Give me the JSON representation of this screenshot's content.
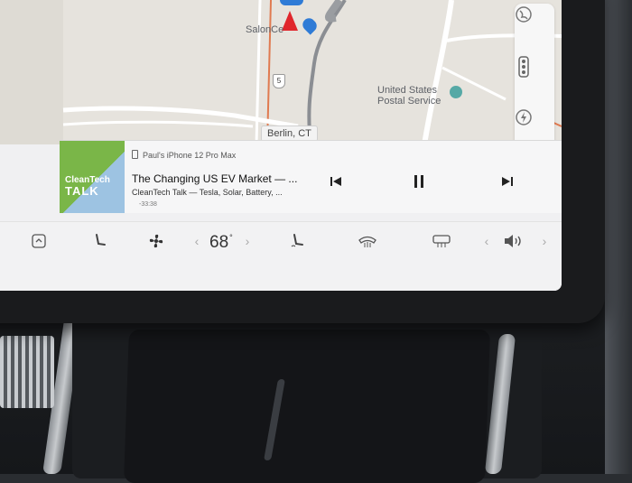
{
  "map": {
    "labels": {
      "salon": "SalonCe",
      "postal_office": "United States\nPostal Service",
      "city": "Berlin, CT",
      "route": "5"
    },
    "controls": [
      "globe-icon",
      "traffic-light-icon",
      "lightning-icon"
    ]
  },
  "media": {
    "artwork": {
      "line1": "CleanTech",
      "line2": "TALK"
    },
    "device": "Paul's iPhone 12 Pro Max",
    "title": "The Changing US EV Market — ...",
    "subtitle": "CleanTech Talk — Tesla, Solar, Battery, ...",
    "time_remaining": "-33:38",
    "controls": [
      "previous-icon",
      "pause-icon",
      "next-icon"
    ]
  },
  "bottom_bar": {
    "temperature": "68",
    "temperature_unit": "°",
    "temp_down": "‹",
    "temp_up": "›",
    "volume_down": "‹",
    "volume_up": "›",
    "colors": {
      "accent_red": "#e0262c",
      "accent_blue": "#2f7bd6"
    }
  }
}
